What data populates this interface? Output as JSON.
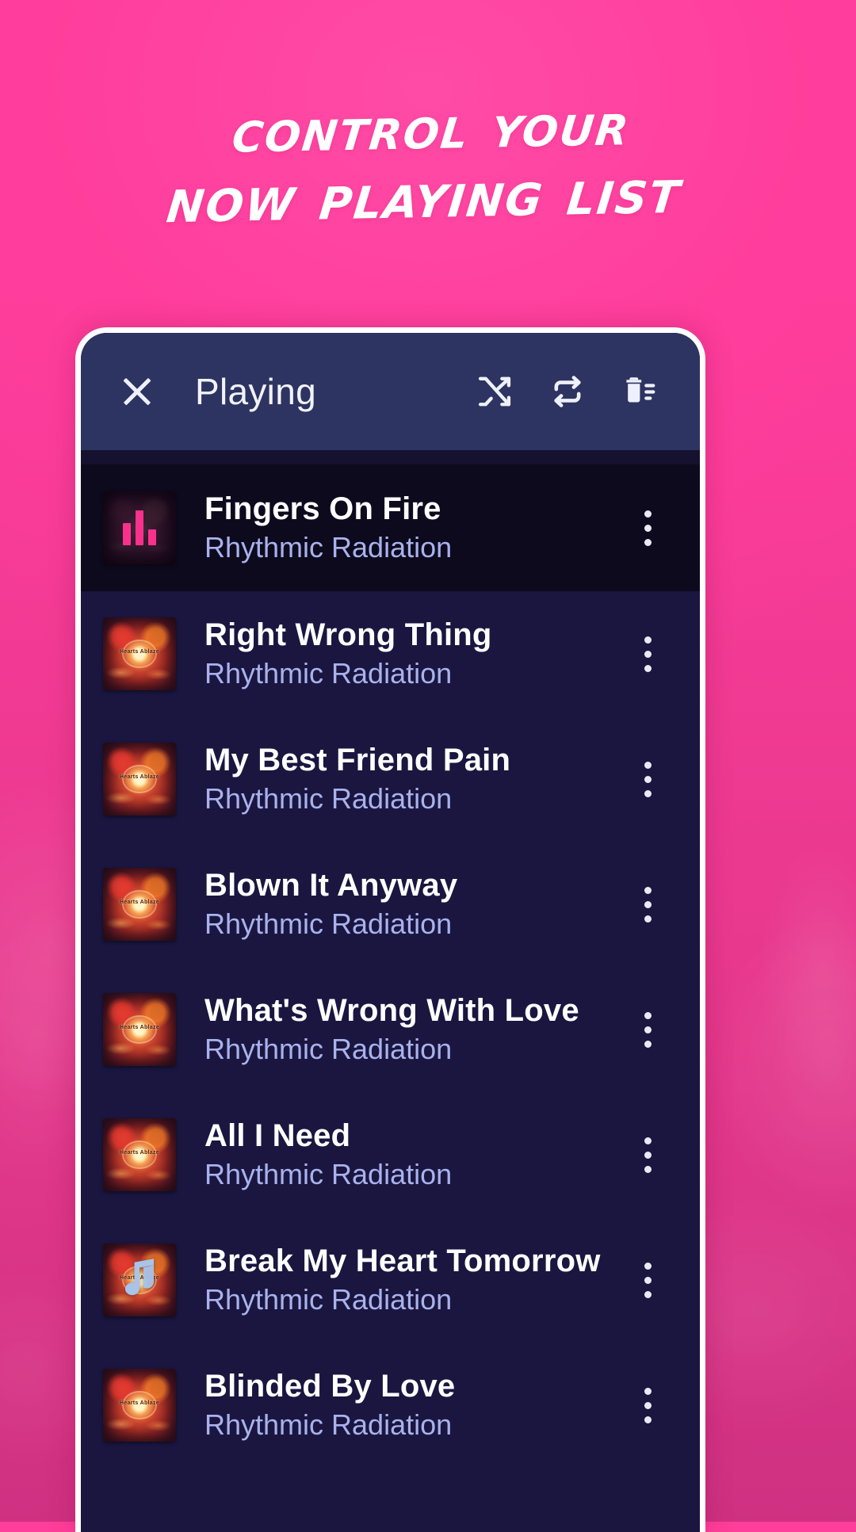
{
  "promo": {
    "headline_line1": "Control your",
    "headline_line2": "Now Playing list",
    "bg_color_top": "#ff3f9d",
    "bg_color_bottom": "#cf3181"
  },
  "toolbar": {
    "title": "Playing",
    "close_icon": "close-icon",
    "shuffle_icon": "shuffle-icon",
    "repeat_icon": "repeat-icon",
    "clear_queue_icon": "delete-list-icon"
  },
  "theme": {
    "toolbar_bg": "#2e3461",
    "list_bg": "#1a1640",
    "active_row_bg": "#0e0a1e",
    "accent_pink": "#f9318c",
    "artist_text": "#a9b2ec",
    "title_text": "#ffffff"
  },
  "queue": {
    "tracks": [
      {
        "title": "Fingers On Fire",
        "artist": "Rhythmic Radiation",
        "state": "playing",
        "art": "equalizer"
      },
      {
        "title": "Right Wrong Thing",
        "artist": "Rhythmic Radiation",
        "state": "queued",
        "art": "album"
      },
      {
        "title": "My Best Friend Pain",
        "artist": "Rhythmic Radiation",
        "state": "queued",
        "art": "album"
      },
      {
        "title": "Blown It Anyway",
        "artist": "Rhythmic Radiation",
        "state": "queued",
        "art": "album"
      },
      {
        "title": "What's Wrong With Love",
        "artist": "Rhythmic Radiation",
        "state": "queued",
        "art": "album"
      },
      {
        "title": "All I Need",
        "artist": "Rhythmic Radiation",
        "state": "queued",
        "art": "album"
      },
      {
        "title": "Break My Heart Tomorrow",
        "artist": "Rhythmic Radiation",
        "state": "queued",
        "art": "album-note"
      },
      {
        "title": "Blinded By Love",
        "artist": "Rhythmic Radiation",
        "state": "queued",
        "art": "album"
      }
    ],
    "album_art_label": "Hearts Ablaze"
  }
}
